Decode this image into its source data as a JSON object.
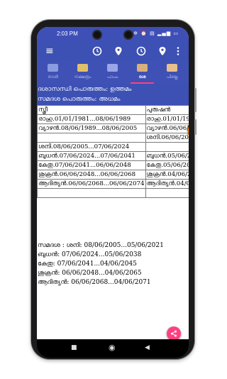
{
  "status_bar": {
    "time": "2:03 PM",
    "icons": "✲ ⏰ ▤ ▂▄▆ ▭"
  },
  "toolbar": {
    "menu_icon": "≡"
  },
  "tabs": [
    {
      "label": "രാശി",
      "color": "#8a9be0"
    },
    {
      "label": "നക്ഷത്രം",
      "color": "#e0c16a"
    },
    {
      "label": "പാപം",
      "color": "#9aa6e6"
    },
    {
      "label": "ദശ",
      "color": "#d9b07a"
    },
    {
      "label": "പില്ലെ",
      "color": "#e8c08c"
    }
  ],
  "header": {
    "line1": "ദശാസന്ധി പൊരുത്തം: ഉത്തമം",
    "line2": "സമദശ പൊരുത്തം: അധമം"
  },
  "table": {
    "headers": [
      "സ്ത്രീ",
      "പുരുഷൻ"
    ],
    "rows": [
      [
        "രാഹു.01/01/1981...08/06/1989",
        "രാഹു.01/01/1989"
      ],
      [
        "വ്യാഴൻ.08/06/1989...08/06/2005",
        "വ്യാഴൻ.06/06/1"
      ],
      [
        "",
        "ശനി.06/06/200"
      ],
      [
        "ശനി.08/06/2005...07/06/2024",
        ""
      ],
      [
        "ബുധൻ.07/06/2024...07/06/2041",
        "ബുധൻ.05/06/2"
      ],
      [
        "കേതു.07/06/2041...06/06/2048",
        "കേതു.05/06/20"
      ],
      [
        "ശുക്രൻ.06/06/2048...06/06/2068",
        "ശുക്രൻ.04/06/2"
      ],
      [
        "ആദിത്യൻ.06/06/2068...06/06/2074",
        "ആദിത്യൻ.04/0"
      ],
      [
        "",
        ""
      ]
    ]
  },
  "samadasa": [
    "സമദശ :  ശനി: 08/06/2005...05/06/2021",
    "ബുധൻ: 07/06/2024...05/06/2038",
    "കേതു: 07/06/2041...04/06/2045",
    "ശുക്രൻ: 06/06/2048...04/06/2065",
    "ആദിത്യൻ: 06/06/2068...04/06/2071"
  ],
  "nav": {
    "back": "◀",
    "home": "◉",
    "recents": "■"
  },
  "colors": {
    "primary": "#3d50b4",
    "accent": "#ff4081"
  }
}
